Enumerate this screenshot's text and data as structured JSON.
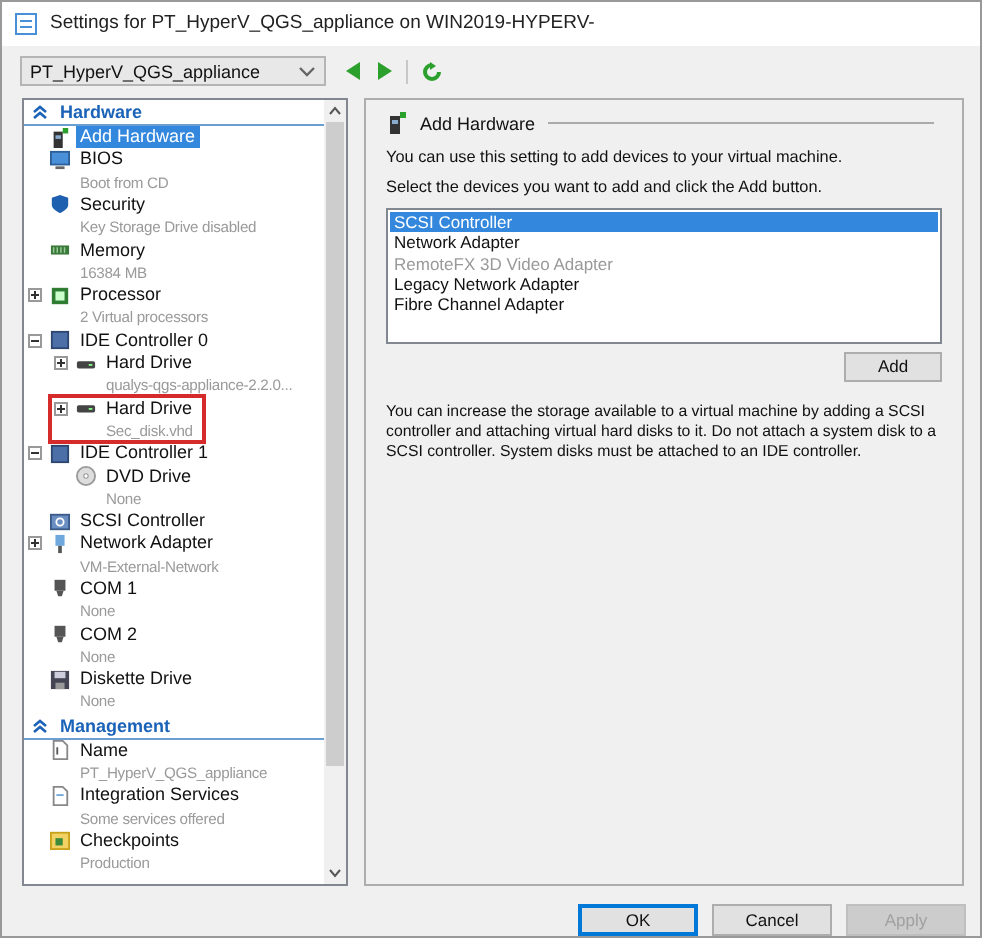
{
  "window": {
    "title": "Settings for PT_HyperV_QGS_appliance on WIN2019-HYPERV-"
  },
  "vm_selector": {
    "value": "PT_HyperV_QGS_appliance"
  },
  "tree": {
    "sections": [
      {
        "title": "Hardware",
        "expanded": true,
        "items": [
          {
            "label": "Add Hardware",
            "selected": true
          },
          {
            "label": "BIOS",
            "detail": "Boot from CD",
            "selected": false
          },
          {
            "label": "Security",
            "detail": "Key Storage Drive disabled",
            "selected": false
          },
          {
            "label": "Memory",
            "detail": "16384 MB",
            "selected": false
          },
          {
            "label": "Processor",
            "detail": "2 Virtual processors",
            "selected": false,
            "expanded": false
          },
          {
            "label": "IDE Controller 0",
            "selected": false,
            "expanded": true,
            "children": [
              {
                "label": "Hard Drive",
                "detail": "qualys-qgs-appliance-2.2.0...",
                "selected": false,
                "expanded": false
              },
              {
                "label": "Hard Drive",
                "detail": "Sec_disk.vhd",
                "selected": false,
                "expanded": false,
                "highlighted": true
              }
            ]
          },
          {
            "label": "IDE Controller 1",
            "selected": false,
            "expanded": true,
            "children": [
              {
                "label": "DVD Drive",
                "detail": "None",
                "selected": false
              }
            ]
          },
          {
            "label": "SCSI Controller",
            "selected": false
          },
          {
            "label": "Network Adapter",
            "detail": "VM-External-Network",
            "selected": false,
            "expanded": false
          },
          {
            "label": "COM 1",
            "detail": "None",
            "selected": false
          },
          {
            "label": "COM 2",
            "detail": "None",
            "selected": false
          },
          {
            "label": "Diskette Drive",
            "detail": "None",
            "selected": false
          }
        ]
      },
      {
        "title": "Management",
        "expanded": true,
        "items": [
          {
            "label": "Name",
            "detail": "PT_HyperV_QGS_appliance",
            "selected": false
          },
          {
            "label": "Integration Services",
            "detail": "Some services offered",
            "selected": false
          },
          {
            "label": "Checkpoints",
            "detail": "Production",
            "selected": false
          }
        ]
      }
    ]
  },
  "panel": {
    "title": "Add Hardware",
    "intro": "You can use this setting to add devices to your virtual machine.",
    "instruction": "Select the devices you want to add and click the Add button.",
    "devices": [
      {
        "label": "SCSI Controller",
        "selected": true,
        "disabled": false
      },
      {
        "label": "Network Adapter",
        "selected": false,
        "disabled": false
      },
      {
        "label": "RemoteFX 3D Video Adapter",
        "selected": false,
        "disabled": true
      },
      {
        "label": "Legacy Network Adapter",
        "selected": false,
        "disabled": false
      },
      {
        "label": "Fibre Channel Adapter",
        "selected": false,
        "disabled": false
      }
    ],
    "add_button": "Add",
    "note": "You can increase the storage available to a virtual machine by adding a SCSI controller and attaching virtual hard disks to it. Do not attach a system disk to a SCSI controller. System disks must be attached to an IDE controller."
  },
  "buttons": [
    {
      "label": "OK",
      "default": true,
      "disabled": false
    },
    {
      "label": "Cancel",
      "default": false,
      "disabled": false
    },
    {
      "label": "Apply",
      "default": false,
      "disabled": true
    }
  ]
}
